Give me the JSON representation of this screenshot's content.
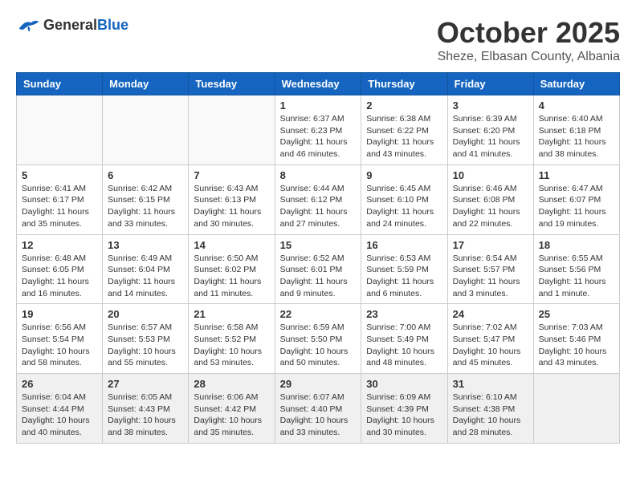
{
  "header": {
    "logo_general": "General",
    "logo_blue": "Blue",
    "month": "October 2025",
    "location": "Sheze, Elbasan County, Albania"
  },
  "weekdays": [
    "Sunday",
    "Monday",
    "Tuesday",
    "Wednesday",
    "Thursday",
    "Friday",
    "Saturday"
  ],
  "weeks": [
    [
      {
        "day": "",
        "empty": true
      },
      {
        "day": "",
        "empty": true
      },
      {
        "day": "",
        "empty": true
      },
      {
        "day": "1",
        "sunrise": "6:37 AM",
        "sunset": "6:23 PM",
        "daylight": "11 hours and 46 minutes."
      },
      {
        "day": "2",
        "sunrise": "6:38 AM",
        "sunset": "6:22 PM",
        "daylight": "11 hours and 43 minutes."
      },
      {
        "day": "3",
        "sunrise": "6:39 AM",
        "sunset": "6:20 PM",
        "daylight": "11 hours and 41 minutes."
      },
      {
        "day": "4",
        "sunrise": "6:40 AM",
        "sunset": "6:18 PM",
        "daylight": "11 hours and 38 minutes."
      }
    ],
    [
      {
        "day": "5",
        "sunrise": "6:41 AM",
        "sunset": "6:17 PM",
        "daylight": "11 hours and 35 minutes."
      },
      {
        "day": "6",
        "sunrise": "6:42 AM",
        "sunset": "6:15 PM",
        "daylight": "11 hours and 33 minutes."
      },
      {
        "day": "7",
        "sunrise": "6:43 AM",
        "sunset": "6:13 PM",
        "daylight": "11 hours and 30 minutes."
      },
      {
        "day": "8",
        "sunrise": "6:44 AM",
        "sunset": "6:12 PM",
        "daylight": "11 hours and 27 minutes."
      },
      {
        "day": "9",
        "sunrise": "6:45 AM",
        "sunset": "6:10 PM",
        "daylight": "11 hours and 24 minutes."
      },
      {
        "day": "10",
        "sunrise": "6:46 AM",
        "sunset": "6:08 PM",
        "daylight": "11 hours and 22 minutes."
      },
      {
        "day": "11",
        "sunrise": "6:47 AM",
        "sunset": "6:07 PM",
        "daylight": "11 hours and 19 minutes."
      }
    ],
    [
      {
        "day": "12",
        "sunrise": "6:48 AM",
        "sunset": "6:05 PM",
        "daylight": "11 hours and 16 minutes."
      },
      {
        "day": "13",
        "sunrise": "6:49 AM",
        "sunset": "6:04 PM",
        "daylight": "11 hours and 14 minutes."
      },
      {
        "day": "14",
        "sunrise": "6:50 AM",
        "sunset": "6:02 PM",
        "daylight": "11 hours and 11 minutes."
      },
      {
        "day": "15",
        "sunrise": "6:52 AM",
        "sunset": "6:01 PM",
        "daylight": "11 hours and 9 minutes."
      },
      {
        "day": "16",
        "sunrise": "6:53 AM",
        "sunset": "5:59 PM",
        "daylight": "11 hours and 6 minutes."
      },
      {
        "day": "17",
        "sunrise": "6:54 AM",
        "sunset": "5:57 PM",
        "daylight": "11 hours and 3 minutes."
      },
      {
        "day": "18",
        "sunrise": "6:55 AM",
        "sunset": "5:56 PM",
        "daylight": "11 hours and 1 minute."
      }
    ],
    [
      {
        "day": "19",
        "sunrise": "6:56 AM",
        "sunset": "5:54 PM",
        "daylight": "10 hours and 58 minutes."
      },
      {
        "day": "20",
        "sunrise": "6:57 AM",
        "sunset": "5:53 PM",
        "daylight": "10 hours and 55 minutes."
      },
      {
        "day": "21",
        "sunrise": "6:58 AM",
        "sunset": "5:52 PM",
        "daylight": "10 hours and 53 minutes."
      },
      {
        "day": "22",
        "sunrise": "6:59 AM",
        "sunset": "5:50 PM",
        "daylight": "10 hours and 50 minutes."
      },
      {
        "day": "23",
        "sunrise": "7:00 AM",
        "sunset": "5:49 PM",
        "daylight": "10 hours and 48 minutes."
      },
      {
        "day": "24",
        "sunrise": "7:02 AM",
        "sunset": "5:47 PM",
        "daylight": "10 hours and 45 minutes."
      },
      {
        "day": "25",
        "sunrise": "7:03 AM",
        "sunset": "5:46 PM",
        "daylight": "10 hours and 43 minutes."
      }
    ],
    [
      {
        "day": "26",
        "sunrise": "6:04 AM",
        "sunset": "4:44 PM",
        "daylight": "10 hours and 40 minutes.",
        "last": true
      },
      {
        "day": "27",
        "sunrise": "6:05 AM",
        "sunset": "4:43 PM",
        "daylight": "10 hours and 38 minutes.",
        "last": true
      },
      {
        "day": "28",
        "sunrise": "6:06 AM",
        "sunset": "4:42 PM",
        "daylight": "10 hours and 35 minutes.",
        "last": true
      },
      {
        "day": "29",
        "sunrise": "6:07 AM",
        "sunset": "4:40 PM",
        "daylight": "10 hours and 33 minutes.",
        "last": true
      },
      {
        "day": "30",
        "sunrise": "6:09 AM",
        "sunset": "4:39 PM",
        "daylight": "10 hours and 30 minutes.",
        "last": true
      },
      {
        "day": "31",
        "sunrise": "6:10 AM",
        "sunset": "4:38 PM",
        "daylight": "10 hours and 28 minutes.",
        "last": true
      },
      {
        "day": "",
        "empty": true,
        "last": true
      }
    ]
  ]
}
